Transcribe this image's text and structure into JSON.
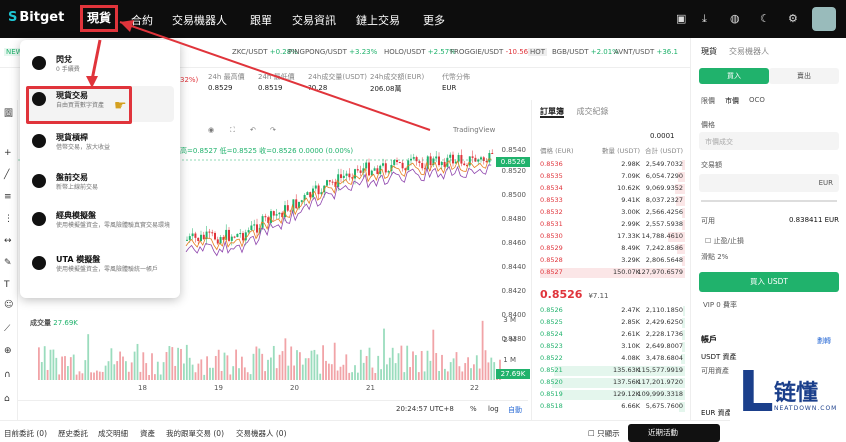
{
  "nav": {
    "logo": "Bitget",
    "items": [
      "現貨",
      "合約",
      "交易機器人",
      "跟單",
      "交易資訊",
      "鏈上交易",
      "更多"
    ]
  },
  "ticker": {
    "new_badge": "NEW",
    "items": [
      {
        "pair": "ZKC/USDT",
        "change": "+0.28%"
      },
      {
        "pair": "PINGPONG/USDT",
        "change": "+3.23%"
      },
      {
        "pair": "HOLO/USDT",
        "change": "+2.57%"
      },
      {
        "pair": "FROGGIE/USDT",
        "change": "-10.56%"
      },
      {
        "pair": "HOT",
        "change": ""
      },
      {
        "pair": "BGB/USDT",
        "change": "+2.01%"
      },
      {
        "pair": "AVNT/USDT",
        "change": "+36.1"
      }
    ]
  },
  "stats": [
    {
      "label": "24h 最高價",
      "value": "0.8529"
    },
    {
      "label": "24h 最低價",
      "value": "0.8519"
    },
    {
      "label": "24h成交量(USDT)",
      "value": "?0.28"
    },
    {
      "label": "24h成交額(EUR)",
      "value": "206.08萬"
    },
    {
      "label": "代幣分佈",
      "value": "EUR"
    }
  ],
  "stats_partial": "32%)",
  "chart": {
    "tradingview_label": "TradingView",
    "info_line": "高=0.8527 低=0.8525 收=0.8526 0.0000 (0.00%)",
    "prices": [
      "0.8540",
      "0.8526",
      "0.8520",
      "0.8500",
      "0.8480",
      "0.8460",
      "0.8440",
      "0.8420",
      "0.8400",
      "0.8380"
    ],
    "current_price": "0.8526",
    "volume_label": "成交量",
    "volume_value": "27.69K",
    "vol_axis": [
      "3 M",
      "2 M",
      "1 M"
    ],
    "vol_current": "27.69K",
    "dates": [
      "18",
      "19",
      "20",
      "21",
      "22"
    ],
    "time": "20:24:57 UTC+8",
    "pct": "%",
    "log": "log",
    "auto": "自動"
  },
  "orderbook": {
    "tabs": [
      "訂單簿",
      "成交紀錄"
    ],
    "precision": "0.0001",
    "headers": [
      "價格 (EUR)",
      "數量 (USDT)",
      "合計 (USDT)"
    ],
    "asks": [
      [
        "0.8536",
        "2.98K",
        "2,549.7032"
      ],
      [
        "0.8535",
        "7.09K",
        "6,054.7290"
      ],
      [
        "0.8534",
        "10.62K",
        "9,069.9352"
      ],
      [
        "0.8533",
        "9.41K",
        "8,037.2327"
      ],
      [
        "0.8532",
        "3.00K",
        "2,566.4256"
      ],
      [
        "0.8531",
        "2.99K",
        "2,557.5938"
      ],
      [
        "0.8530",
        "17.33K",
        "14,788.4610"
      ],
      [
        "0.8529",
        "8.49K",
        "7,242.8586"
      ],
      [
        "0.8528",
        "3.29K",
        "2,806.5648"
      ],
      [
        "0.8527",
        "150.07K",
        "127,970.6579"
      ]
    ],
    "mid": "0.8526",
    "mid_sub": "¥7.11",
    "bids": [
      [
        "0.8526",
        "2.47K",
        "2,110.1850"
      ],
      [
        "0.8525",
        "2.85K",
        "2,429.6250"
      ],
      [
        "0.8524",
        "2.61K",
        "2,228.1736"
      ],
      [
        "0.8523",
        "3.10K",
        "2,649.8007"
      ],
      [
        "0.8522",
        "4.08K",
        "3,478.6804"
      ],
      [
        "0.8521",
        "135.63K",
        "115,577.9919"
      ],
      [
        "0.8520",
        "137.56K",
        "117,201.9720"
      ],
      [
        "0.8519",
        "129.12K",
        "109,999.3318"
      ],
      [
        "0.8518",
        "6.66K",
        "5,675.7600"
      ]
    ]
  },
  "trade": {
    "tabs": [
      "現貨",
      "交易機器人"
    ],
    "buy": "買入",
    "sell": "賣出",
    "order_types": [
      "限價",
      "市價",
      "OCO"
    ],
    "price_label": "價格",
    "price_placeholder": "市價成交",
    "amount_label": "交易額",
    "currency": "EUR",
    "available_label": "可用",
    "available_value": "0.838411 EUR",
    "tpsl": "止盈/止損",
    "slippage": "滑點 2%",
    "buy_button": "買入 USDT",
    "vip": "VIP 0 費率",
    "account_title": "帳戶",
    "deposit": "劃轉",
    "asset_label": "USDT 資產",
    "avail_assets": "可用資產",
    "eur_asset": "EUR 資產"
  },
  "dropdown": [
    {
      "title": "閃兌",
      "desc": "0 手續費"
    },
    {
      "title": "現貨交易",
      "desc": "自由買賣數字資產"
    },
    {
      "title": "現貨槓桿",
      "desc": "借幣交易，放大收益"
    },
    {
      "title": "盤前交易",
      "desc": "新幣上線前交易"
    },
    {
      "title": "經典模擬盤",
      "desc": "使用模擬盤資金，零風險體驗真實交易環境"
    },
    {
      "title": "UTA 模擬盤",
      "desc": "使用模擬盤資金，零風險體驗統一帳戶"
    }
  ],
  "bottom_tabs": [
    "目前委託 (0)",
    "歷史委託",
    "成交明細",
    "資產",
    "我的跟單交易 (0)",
    "交易機器人 (0)"
  ],
  "only_current": "只顯示",
  "recent": "近期活動",
  "watermark": {
    "cn": "链懂",
    "en": "NEATDOWN.COM"
  },
  "colors": {
    "up": "#20b26c",
    "down": "#e0343b",
    "annotation": "#e0343b"
  }
}
